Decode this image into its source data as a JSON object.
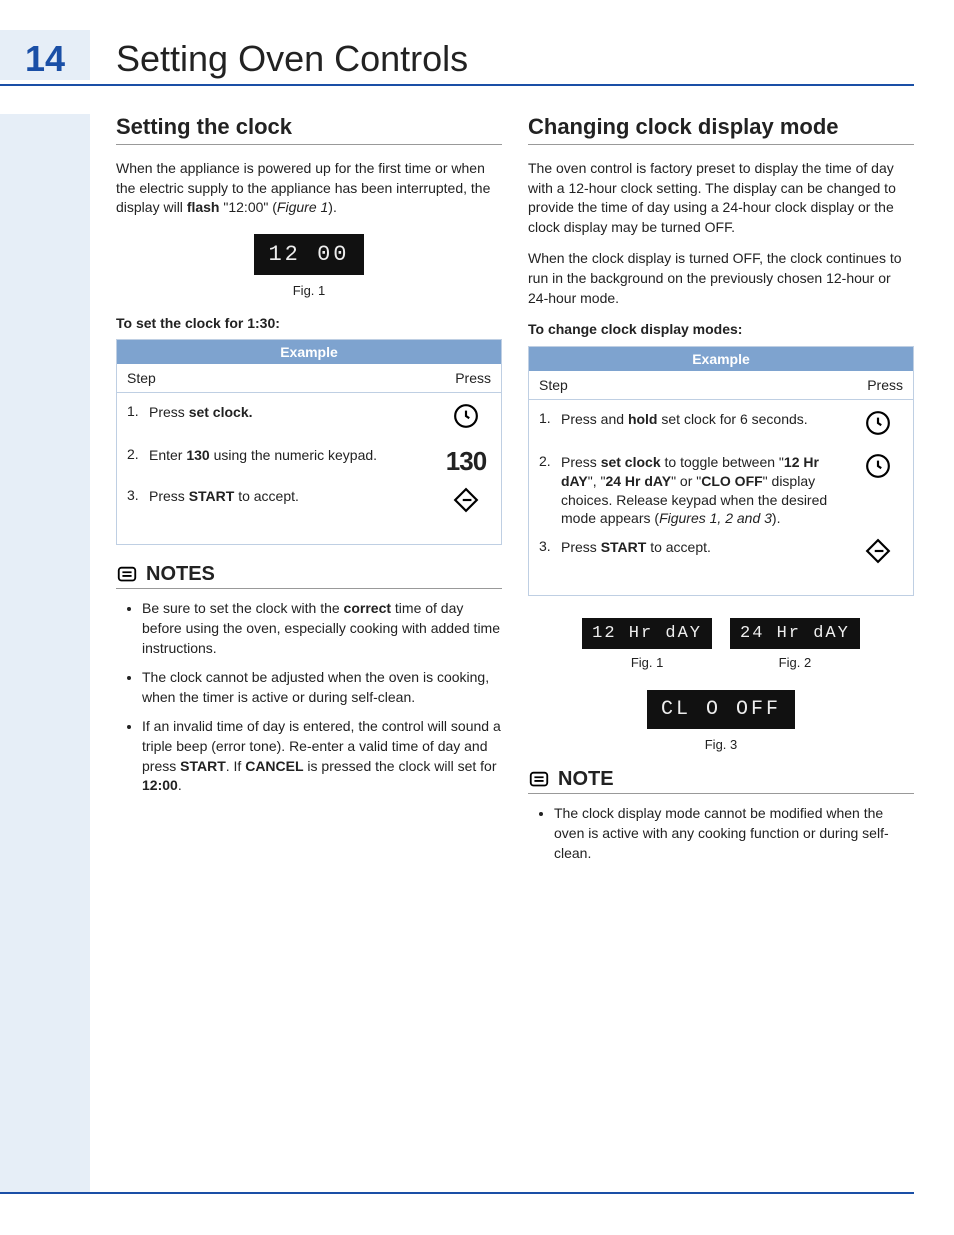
{
  "page_number": "14",
  "page_title": "Setting Oven Controls",
  "left": {
    "heading": "Setting the clock",
    "intro_a": "When the appliance is powered up for the first time or when the electric supply to the appliance has been interrupted, the display will ",
    "intro_b": "flash",
    "intro_c": " \"12:00\" (",
    "intro_d": "Figure 1",
    "intro_e": ").",
    "lcd1": "12 00",
    "fig1": "Fig. 1",
    "subhead": "To set the clock for 1:30:",
    "example_label": "Example",
    "col_step": "Step",
    "col_press": "Press",
    "steps": {
      "s1_a": "Press ",
      "s1_b": "set clock.",
      "s2_a": "Enter ",
      "s2_b": "130",
      "s2_c": " using the  numeric keypad.",
      "s3_a": "Press ",
      "s3_b": "START",
      "s3_c": " to accept."
    },
    "press_130": "130",
    "notes_heading": "NOTES",
    "notes": {
      "n1_a": "Be sure to set the clock with the ",
      "n1_b": "correct",
      "n1_c": " time of day before using the oven, especially cooking with added time instructions.",
      "n2": "The clock cannot be adjusted when the oven is cooking, when the timer is active or during self-clean.",
      "n3_a": "If an invalid time of day is entered, the control will sound a triple beep (error tone). Re-enter a valid time of day and press ",
      "n3_b": "START",
      "n3_c": ". If ",
      "n3_d": "CANCEL",
      "n3_e": " is pressed the clock will set for ",
      "n3_f": "12:00",
      "n3_g": "."
    }
  },
  "right": {
    "heading": "Changing clock display mode",
    "p1": "The oven control is factory preset to display the time of day with a 12-hour clock setting. The display can be changed to provide the time of day using a 24-hour clock display or the clock display may be turned OFF.",
    "p2": "When the clock display is turned OFF, the clock continues to run in the background on the previously chosen 12-hour or 24-hour mode.",
    "subhead": "To change clock display modes:",
    "example_label": "Example",
    "col_step": "Step",
    "col_press": "Press",
    "steps": {
      "s1_a": "Press and ",
      "s1_b": "hold",
      "s1_c": " set clock for 6 seconds.",
      "s2_a": "Press ",
      "s2_b": "set clock",
      "s2_c": " to toggle between \"",
      "s2_d": "12 Hr dAY",
      "s2_e": "\", \"",
      "s2_f": "24 Hr dAY",
      "s2_g": "\" or \"",
      "s2_h": "CLO OFF",
      "s2_i": "\" display choices. Release keypad when the desired mode appears (",
      "s2_j": "Figures 1, 2 and 3",
      "s2_k": ").",
      "s3_a": "Press ",
      "s3_b": "START",
      "s3_c": " to accept."
    },
    "lcd_12": "12 Hr  dAY",
    "lcd_24": "24 Hr  dAY",
    "lcd_off": "CL O   OFF",
    "fig1": "Fig. 1",
    "fig2": "Fig. 2",
    "fig3": "Fig. 3",
    "note_heading": "NOTE",
    "note1": "The clock display mode cannot be modified when the oven is active with any cooking function or during self-clean."
  }
}
